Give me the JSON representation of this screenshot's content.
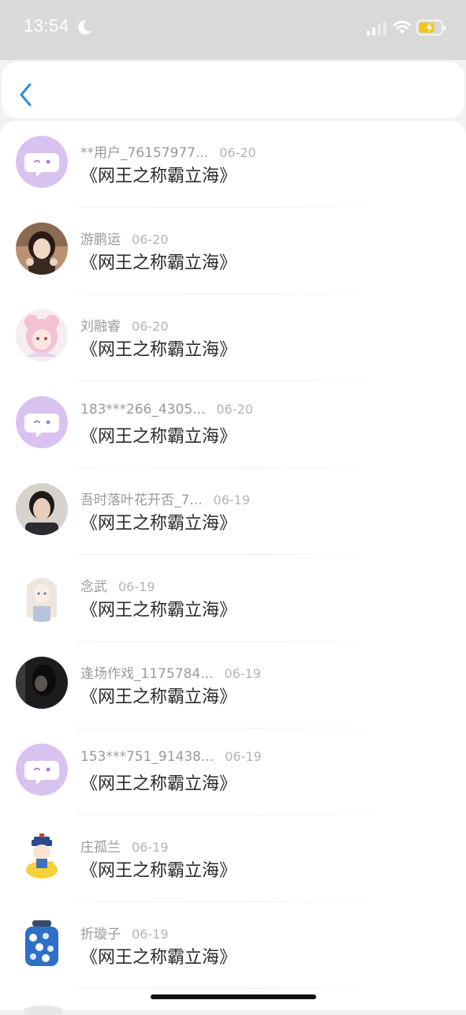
{
  "status_bar": {
    "time": "13:54",
    "icons": [
      "moon-icon",
      "signal-icon",
      "wifi-icon",
      "battery-charging-icon"
    ]
  },
  "nav": {
    "back_icon": "chevron-left-icon",
    "accent_color": "#2a8de6"
  },
  "items": [
    {
      "user": "**用户_76157977...",
      "date": "06-20",
      "title": "《网王之称霸立海》",
      "avatar": "default-chat-avatar"
    },
    {
      "user": "游鹏运",
      "date": "06-20",
      "title": "《网王之称霸立海》",
      "avatar": "photo-avatar"
    },
    {
      "user": "刘融睿",
      "date": "06-20",
      "title": "《网王之称霸立海》",
      "avatar": "anime-girl-avatar"
    },
    {
      "user": "183***266_4305...",
      "date": "06-20",
      "title": "《网王之称霸立海》",
      "avatar": "default-chat-avatar"
    },
    {
      "user": "吾时落叶花开否_7...",
      "date": "06-19",
      "title": "《网王之称霸立海》",
      "avatar": "photo-avatar"
    },
    {
      "user": "念武",
      "date": "06-19",
      "title": "《网王之称霸立海》",
      "avatar": "anime-girl-avatar"
    },
    {
      "user": "逢场作戏_1175784...",
      "date": "06-19",
      "title": "《网王之称霸立海》",
      "avatar": "photo-avatar"
    },
    {
      "user": "153***751_91438...",
      "date": "06-19",
      "title": "《网王之称霸立海》",
      "avatar": "default-chat-avatar"
    },
    {
      "user": "庄孤兰",
      "date": "06-19",
      "title": "《网王之称霸立海》",
      "avatar": "cartoon-duck-avatar"
    },
    {
      "user": "折璇子",
      "date": "06-19",
      "title": "《网王之称霸立海》",
      "avatar": "jar-avatar"
    }
  ],
  "colors": {
    "status_bar_bg": "#d9d9d9",
    "default_avatar_bg": "#d9c2f0",
    "default_avatar_accent": "#a77fd9",
    "battery_charging": "#f5c518"
  }
}
